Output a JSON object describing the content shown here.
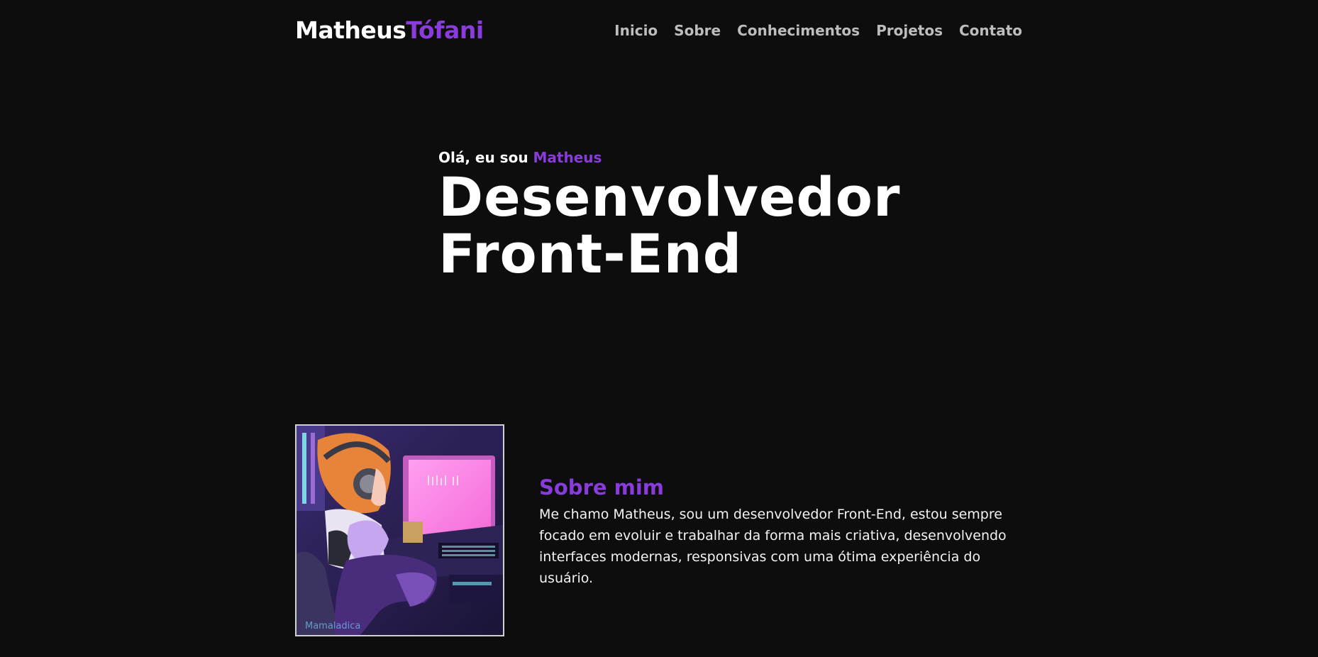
{
  "header": {
    "logo_first": "Matheus",
    "logo_last": "Tófani",
    "nav": [
      "Inicio",
      "Sobre",
      "Conhecimentos",
      "Projetos",
      "Contato"
    ]
  },
  "hero": {
    "greeting": "Olá, eu sou",
    "greeting_name": "Matheus",
    "title_line1": "Desenvolvedor",
    "title_line2": "Front-End"
  },
  "about": {
    "heading": "Sobre mim",
    "body": "Me chamo Matheus, sou um desenvolvedor Front-End, estou sempre focado em evoluir e trabalhar da forma mais criativa, desenvolvendo interfaces modernas, responsivas com uma ótima experiência do usuário.",
    "image_signature": "Mamaladica"
  },
  "colors": {
    "background": "#0d0d0d",
    "accent": "#8a3bdb",
    "nav_text": "#bdbdbd"
  }
}
